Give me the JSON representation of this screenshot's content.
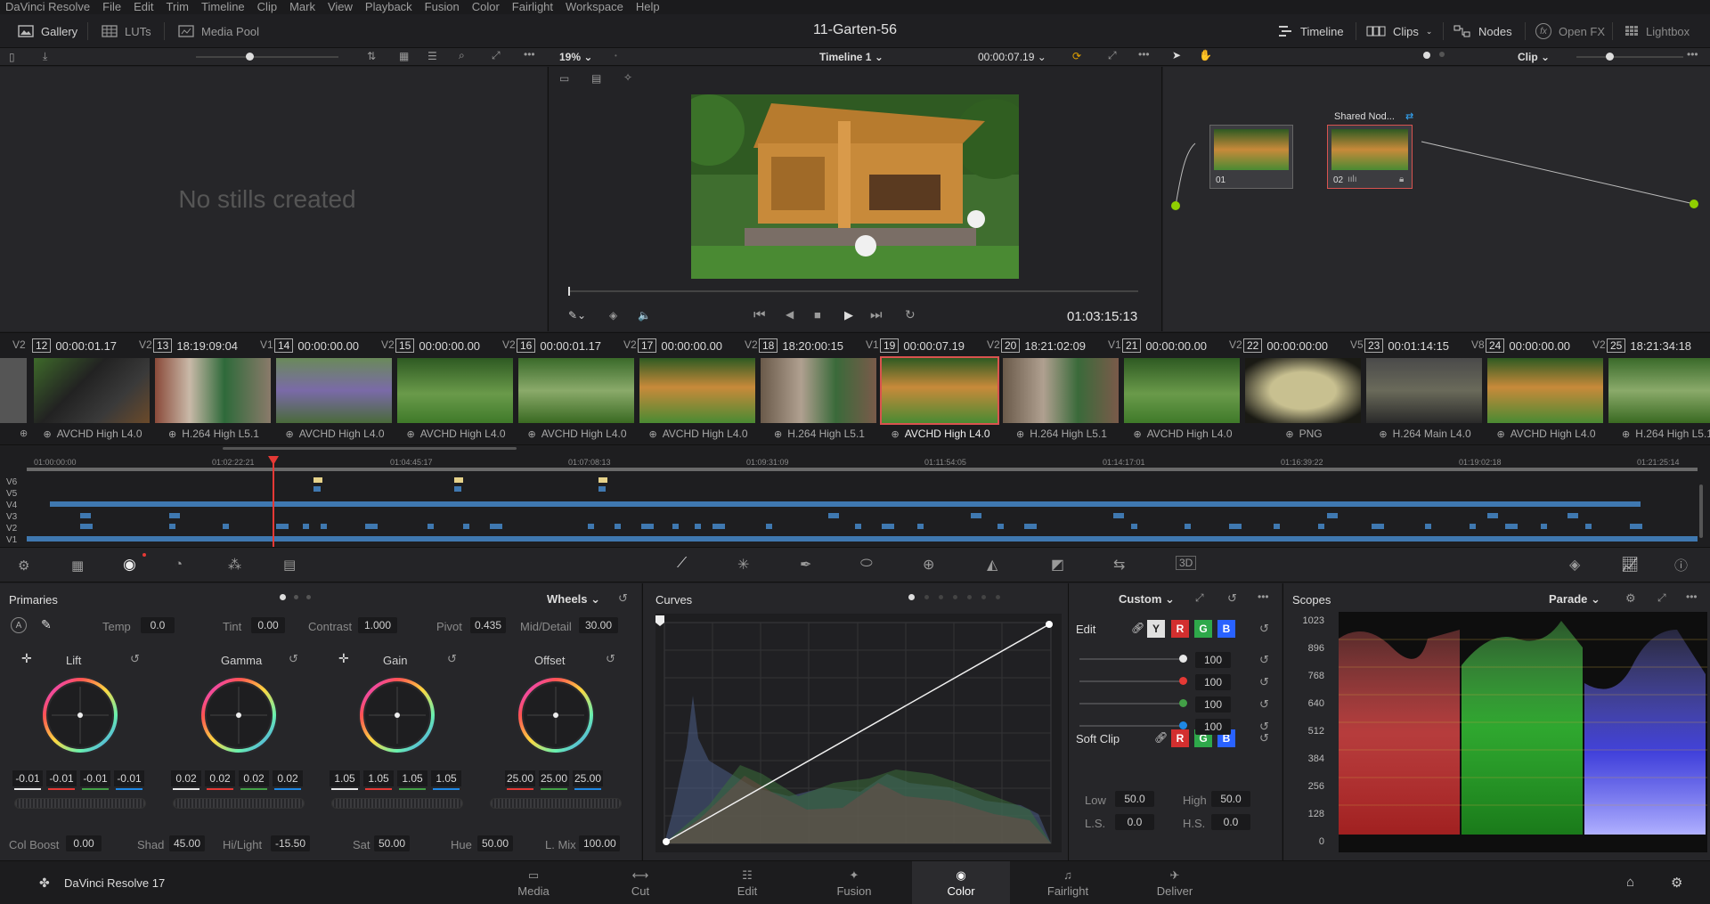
{
  "menu": [
    "DaVinci Resolve",
    "File",
    "Edit",
    "Trim",
    "Timeline",
    "Clip",
    "Mark",
    "View",
    "Playback",
    "Fusion",
    "Color",
    "Fairlight",
    "Workspace",
    "Help"
  ],
  "toolbar": {
    "gallery": "Gallery",
    "luts": "LUTs",
    "media_pool": "Media Pool",
    "project_title": "11-Garten-56",
    "timeline": "Timeline",
    "clips": "Clips",
    "nodes": "Nodes",
    "openfx": "Open FX",
    "lightbox": "Lightbox"
  },
  "viewer": {
    "zoom": "19%",
    "timeline_name": "Timeline 1",
    "timecode_top": "00:00:07.19",
    "timecode_main": "01:03:15:13"
  },
  "gallery": {
    "empty_text": "No stills created"
  },
  "nodes": {
    "mode": "Clip",
    "shared_label": "Shared Nod...",
    "node1_label": "01",
    "node2_label": "02"
  },
  "clips": [
    {
      "num": "12",
      "tc": "00:00:01.17",
      "track": "V2",
      "codec": "AVCHD High L4.0",
      "thumb": "bbq"
    },
    {
      "num": "13",
      "tc": "18:19:09:04",
      "track": "V1",
      "codec": "H.264 High L5.1",
      "thumb": "people"
    },
    {
      "num": "14",
      "tc": "00:00:00.00",
      "track": "V2",
      "codec": "AVCHD High L4.0",
      "thumb": "lavender"
    },
    {
      "num": "15",
      "tc": "00:00:00.00",
      "track": "V2",
      "codec": "AVCHD High L4.0",
      "thumb": "garden"
    },
    {
      "num": "16",
      "tc": "00:00:01.17",
      "track": "V2",
      "codec": "AVCHD High L4.0",
      "thumb": "garden2"
    },
    {
      "num": "17",
      "tc": "00:00:00.00",
      "track": "V2",
      "codec": "AVCHD High L4.0",
      "thumb": "hut"
    },
    {
      "num": "18",
      "tc": "18:20:00:15",
      "track": "V1",
      "codec": "H.264 High L5.1",
      "thumb": "people2"
    },
    {
      "num": "19",
      "tc": "00:00:07.19",
      "track": "V2",
      "codec": "AVCHD High L4.0",
      "thumb": "hut"
    },
    {
      "num": "20",
      "tc": "18:21:02:09",
      "track": "V1",
      "codec": "H.264 High L5.1",
      "thumb": "people2"
    },
    {
      "num": "21",
      "tc": "00:00:00.00",
      "track": "V2",
      "codec": "AVCHD High L4.0",
      "thumb": "garden"
    },
    {
      "num": "22",
      "tc": "00:00:00:00",
      "track": "V5",
      "codec": "PNG",
      "thumb": "png"
    },
    {
      "num": "23",
      "tc": "00:01:14:15",
      "track": "V8",
      "codec": "H.264 Main L4.0",
      "thumb": "stones"
    },
    {
      "num": "24",
      "tc": "00:00:00.00",
      "track": "V2",
      "codec": "AVCHD High L4.0",
      "thumb": "hut"
    },
    {
      "num": "25",
      "tc": "18:21:34:18",
      "track": "",
      "codec": "H.264 High L5.1",
      "thumb": "garden2"
    }
  ],
  "first_track": "V2",
  "ruler": [
    "01:00:00:00",
    "01:02:22:21",
    "01:04:45:17",
    "01:07:08:13",
    "01:09:31:09",
    "01:11:54:05",
    "01:14:17:01",
    "01:16:39:22",
    "01:19:02:18",
    "01:21:25:14"
  ],
  "tracks": [
    "V6",
    "V5",
    "V4",
    "V3",
    "V2",
    "V1"
  ],
  "primaries": {
    "title": "Primaries",
    "mode": "Wheels",
    "temp_label": "Temp",
    "temp": "0.0",
    "tint_label": "Tint",
    "tint": "0.00",
    "contrast_label": "Contrast",
    "contrast": "1.000",
    "pivot_label": "Pivot",
    "pivot": "0.435",
    "middetail_label": "Mid/Detail",
    "middetail": "30.00",
    "wheels": [
      {
        "label": "Lift",
        "values": [
          "-0.01",
          "-0.01",
          "-0.01",
          "-0.01"
        ]
      },
      {
        "label": "Gamma",
        "values": [
          "0.02",
          "0.02",
          "0.02",
          "0.02"
        ]
      },
      {
        "label": "Gain",
        "values": [
          "1.05",
          "1.05",
          "1.05",
          "1.05"
        ]
      },
      {
        "label": "Offset",
        "values": [
          "25.00",
          "25.00",
          "25.00"
        ]
      }
    ],
    "colboost_label": "Col Boost",
    "colboost": "0.00",
    "shad_label": "Shad",
    "shad": "45.00",
    "hilight_label": "Hi/Light",
    "hilight": "-15.50",
    "sat_label": "Sat",
    "sat": "50.00",
    "hue_label": "Hue",
    "hue": "50.00",
    "lmix_label": "L. Mix",
    "lmix": "100.00"
  },
  "curves": {
    "title": "Curves",
    "mode": "Custom",
    "edit_label": "Edit",
    "softclip_label": "Soft Clip",
    "y": "Y",
    "r": "R",
    "g": "G",
    "b": "B",
    "intensity": [
      "100",
      "100",
      "100",
      "100"
    ],
    "low_label": "Low",
    "low": "50.0",
    "high_label": "High",
    "high": "50.0",
    "ls_label": "L.S.",
    "ls": "0.0",
    "hs_label": "H.S.",
    "hs": "0.0"
  },
  "scopes": {
    "title": "Scopes",
    "mode": "Parade",
    "scale": [
      "1023",
      "896",
      "768",
      "640",
      "512",
      "384",
      "256",
      "128",
      "0"
    ]
  },
  "bottom": {
    "app_name": "DaVinci Resolve 17",
    "pages": [
      "Media",
      "Cut",
      "Edit",
      "Fusion",
      "Color",
      "Fairlight",
      "Deliver"
    ],
    "active": "Color"
  }
}
